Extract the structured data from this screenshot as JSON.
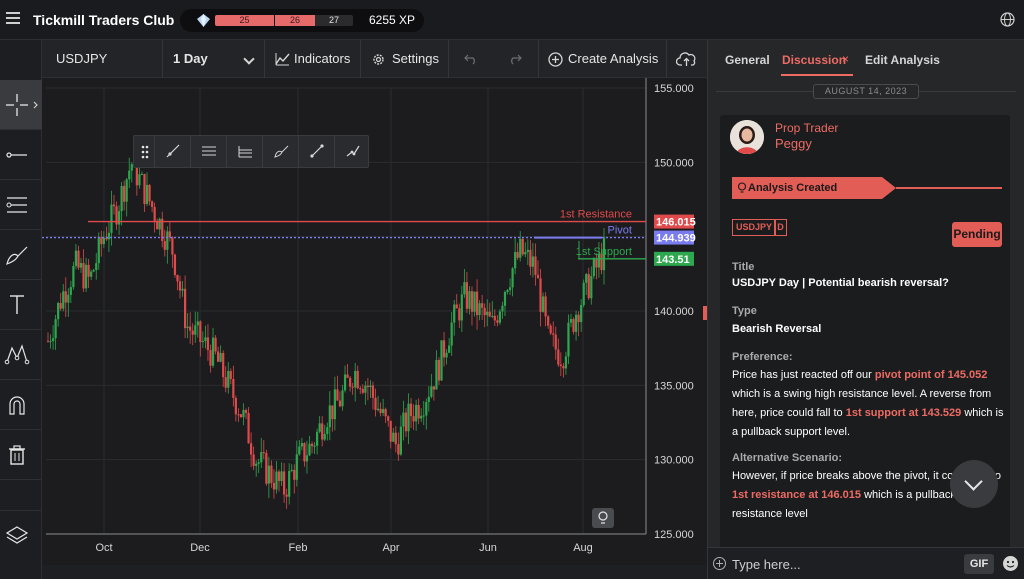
{
  "app": {
    "title": "Tickmill Traders Club"
  },
  "xp": {
    "level_a": "25",
    "level_b": "26",
    "level_c": "27",
    "points": "6255 XP"
  },
  "toolbar": {
    "symbol": "USDJPY",
    "interval": "1 Day",
    "indicators_label": "Indicators",
    "settings_label": "Settings",
    "create_label": "Create Analysis"
  },
  "chart_data": {
    "type": "candlestick",
    "x_ticks": [
      "Oct",
      "Dec",
      "Feb",
      "Apr",
      "Jun",
      "Aug"
    ],
    "y_ticks": [
      "155.000",
      "150.000",
      "145.000",
      "140.000",
      "135.000",
      "130.000",
      "125.000"
    ],
    "ylim": [
      125,
      155
    ],
    "levels": [
      {
        "name": "1st Resistance",
        "value": 146.015,
        "label": "146.015",
        "color": "#e04a4a"
      },
      {
        "name": "Pivot",
        "value": 144.939,
        "label": "144.939",
        "color": "#7b7bf0"
      },
      {
        "name": "1st Support",
        "value": 143.51,
        "label": "143.51",
        "color": "#2ea84e"
      }
    ],
    "price_path": [
      138,
      141,
      143,
      142,
      145,
      147,
      150,
      148,
      146,
      144,
      139,
      138,
      137,
      135,
      133,
      130,
      129,
      128,
      130,
      131,
      133,
      134,
      136,
      135,
      133,
      131,
      133,
      134,
      136,
      139,
      141,
      140,
      139,
      142,
      144,
      143,
      138,
      137,
      140,
      142,
      144
    ],
    "up_color": "#2ea84e",
    "down_color": "#e04a4a"
  },
  "panel": {
    "tabs": [
      "General",
      "Discussion",
      "Edit Analysis"
    ],
    "date": "AUGUST 14, 2023",
    "author_role": "Prop Trader",
    "author_name": "Peggy",
    "status_banner": "Analysis Created",
    "symbol_badge": "USDJPY",
    "timeframe_badge": "D",
    "pending_label": "Pending",
    "title_label": "Title",
    "title_value": "USDJPY Day | Potential bearish reversal?",
    "type_label": "Type",
    "type_value": "Bearish Reversal",
    "preference_label": "Preference:",
    "preference_text": {
      "p1": "Price has just reacted off our ",
      "h1": "pivot point of 145.052",
      "p2": " which is a swing high resistance level. A reverse from here, price could fall to ",
      "h2": "1st support at 143.529",
      "p3": " which is a pullback support level."
    },
    "alt_label": "Alternative Scenario:",
    "alt_text": {
      "p1": "However, if price breaks above the pivot, it could rise to ",
      "h1": "1st resistance at 146.015",
      "p2": " which is a pullback resistance level"
    },
    "composer_placeholder": "Type here...",
    "gif_label": "GIF"
  }
}
